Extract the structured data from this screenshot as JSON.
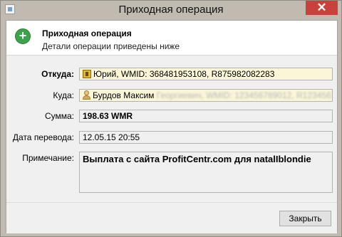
{
  "window": {
    "title": "Приходная операция"
  },
  "header": {
    "title": "Приходная операция",
    "subtitle": "Детали операции приведены ниже"
  },
  "fields": {
    "from": {
      "label": "Откуда:",
      "value": "Юрий, WMID: 368481953108, R875982082283"
    },
    "to": {
      "label": "Куда:",
      "value": "Бурдов Максим",
      "blurred": "Георгиевич, WMID: 123456789012, R123456789"
    },
    "amount": {
      "label": "Сумма:",
      "value": "198.63 WMR"
    },
    "date": {
      "label": "Дата перевода:",
      "value": "12.05.15 20:55"
    },
    "note": {
      "label": "Примечание:",
      "value": "Выплата с сайта ProfitCentr.com для natalIblondie"
    }
  },
  "footer": {
    "close_label": "Закрыть"
  }
}
